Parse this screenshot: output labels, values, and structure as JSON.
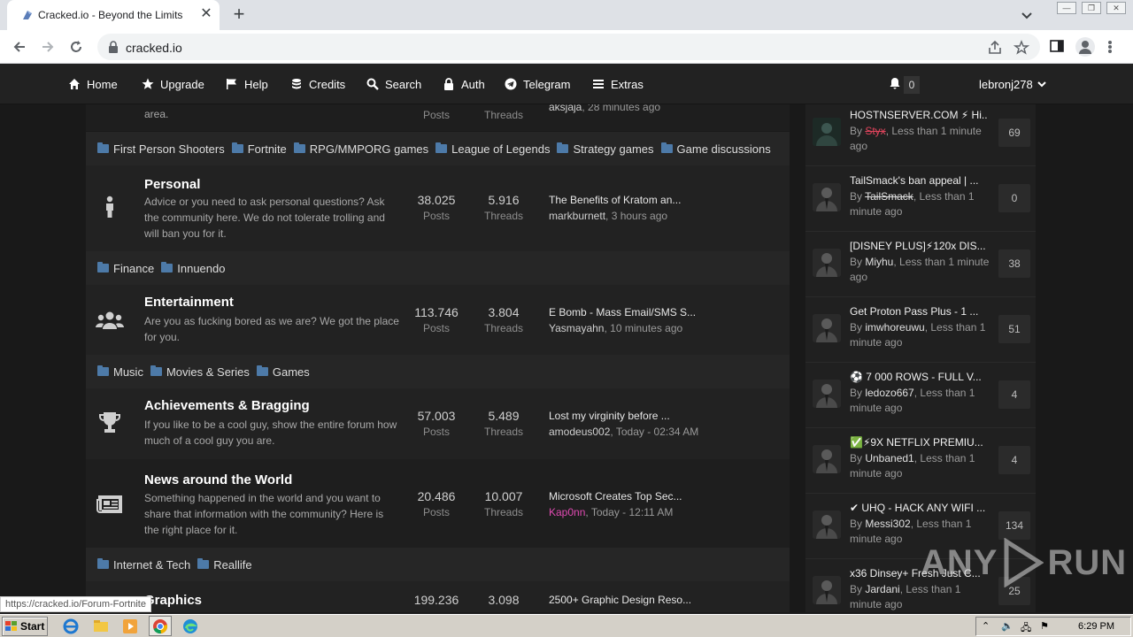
{
  "browser": {
    "tab_title": "Cracked.io - Beyond the Limits",
    "url": "cracked.io",
    "status_url": "https://cracked.io/Forum-Fortnite"
  },
  "nav": {
    "items": [
      {
        "label": "Home",
        "icon": "home-icon"
      },
      {
        "label": "Upgrade",
        "icon": "star-icon"
      },
      {
        "label": "Help",
        "icon": "flag-icon"
      },
      {
        "label": "Credits",
        "icon": "coins-icon"
      },
      {
        "label": "Search",
        "icon": "search-icon"
      },
      {
        "label": "Auth",
        "icon": "lock-icon"
      },
      {
        "label": "Telegram",
        "icon": "telegram-icon"
      },
      {
        "label": "Extras",
        "icon": "menu-icon"
      }
    ],
    "notification_count": "0",
    "username": "lebronj278"
  },
  "forum": {
    "partial_top": {
      "desc": "area.",
      "posts_label": "Posts",
      "threads_label": "Threads",
      "last_author": "aksjaja",
      "last_time": ", 28 minutes ago"
    },
    "subcats_1": [
      "First Person Shooters",
      "Fortnite",
      "RPG/MMPORG games",
      "League of Legends",
      "Strategy games",
      "Game discussions"
    ],
    "personal": {
      "title": "Personal",
      "desc": "Advice or you need to ask personal questions? Ask the community here. We do not tolerate trolling and will ban you for it.",
      "posts": "38.025",
      "posts_label": "Posts",
      "threads": "5.916",
      "threads_label": "Threads",
      "last_title": "The Benefits of Kratom an...",
      "last_author": "markburnett",
      "last_time": ", 3 hours ago"
    },
    "subcats_2": [
      "Finance",
      "Innuendo"
    ],
    "entertainment": {
      "title": "Entertainment",
      "desc": "Are you as fucking bored as we are? We got the place for you.",
      "posts": "113.746",
      "posts_label": "Posts",
      "threads": "3.804",
      "threads_label": "Threads",
      "last_title": "E Bomb - Mass Email/SMS S...",
      "last_author": "Yasmayahn",
      "last_time": ", 10 minutes ago"
    },
    "subcats_3": [
      "Music",
      "Movies & Series",
      "Games"
    ],
    "achievements": {
      "title": "Achievements & Bragging",
      "desc": "If you like to be a cool guy, show the entire forum how much of a cool guy you are.",
      "posts": "57.003",
      "posts_label": "Posts",
      "threads": "5.489",
      "threads_label": "Threads",
      "last_title": "Lost my virginity before ...",
      "last_author": "amodeus002",
      "last_time": ", Today - 02:34 AM"
    },
    "news": {
      "title": "News around the World",
      "desc": "Something happened in the world and you want to share that information with the community? Here is the right place for it.",
      "posts": "20.486",
      "posts_label": "Posts",
      "threads": "10.007",
      "threads_label": "Threads",
      "last_title": "Microsoft Creates Top Sec...",
      "last_author": "Kap0nn",
      "last_time": ", Today - 12:11 AM"
    },
    "subcats_4": [
      "Internet & Tech",
      "Reallife"
    ],
    "graphics": {
      "title": "Graphics",
      "posts": "199.236",
      "threads": "3.098",
      "last_title": "2500+ Graphic Design Reso..."
    }
  },
  "sidebar": {
    "items": [
      {
        "title": "HOSTNSERVER.COM ⚡ Hi...",
        "by": "By ",
        "author": "Styx",
        "time": ", Less than 1 minute ago",
        "count": "69"
      },
      {
        "title": "TailSmack's ban appeal | ...",
        "by": "By ",
        "author": "TailSmack",
        "time": ", Less than 1 minute ago",
        "count": "0"
      },
      {
        "title": "[DISNEY PLUS]⚡120x DIS...",
        "by": "By ",
        "author": "Miyhu",
        "time": ", Less than 1 minute ago",
        "count": "38"
      },
      {
        "title": "Get Proton Pass Plus - 1 ...",
        "by": "By ",
        "author": "imwhoreuwu",
        "time": ", Less than 1 minute ago",
        "count": "51"
      },
      {
        "title": "⚽ 7 000 ROWS - FULL V...",
        "by": "By ",
        "author": "ledozo667",
        "time": ", Less than 1 minute ago",
        "count": "4"
      },
      {
        "title": "✅⚡9X NETFLIX PREMIU...",
        "by": "By ",
        "author": "Unbaned1",
        "time": ", Less than 1 minute ago",
        "count": "4"
      },
      {
        "title": "✔ UHQ - HACK ANY WIFI ...",
        "by": "By ",
        "author": "Messi302",
        "time": ", Less than 1 minute ago",
        "count": "134"
      },
      {
        "title": "x36 Dinsey+ Fresh Just C...",
        "by": "By ",
        "author": "Jardani",
        "time": ", Less than 1 minute ago",
        "count": "25"
      }
    ]
  },
  "watermark": {
    "text_left": "ANY",
    "text_right": "RUN"
  },
  "taskbar": {
    "start_label": "Start",
    "clock": "6:29 PM"
  }
}
